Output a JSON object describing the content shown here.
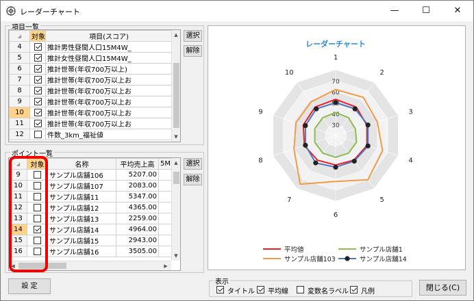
{
  "window": {
    "title": "レーダーチャート",
    "minimize": "—",
    "maximize": "☐",
    "close": "✕"
  },
  "items_group": {
    "label": "項目一覧",
    "headers": [
      "対象",
      "項目(スコア)"
    ],
    "rows": [
      {
        "n": "4",
        "checked": true,
        "name": "推計男性昼間人口15M4W_"
      },
      {
        "n": "5",
        "checked": true,
        "name": "推計女性昼間人口15M4W_"
      },
      {
        "n": "6",
        "checked": true,
        "name": "推計世帯(年収700万以上)"
      },
      {
        "n": "7",
        "checked": true,
        "name": "推計世帯(年収700万以上お"
      },
      {
        "n": "8",
        "checked": true,
        "name": "推計世帯(年収700万以上お"
      },
      {
        "n": "9",
        "checked": true,
        "name": "推計世帯(年収700万以上お"
      },
      {
        "n": "10",
        "checked": true,
        "name": "推計世帯(年収700万以上お"
      },
      {
        "n": "11",
        "checked": true,
        "name": "推計世帯(年収700万以上お"
      },
      {
        "n": "12",
        "checked": false,
        "name": "件数_3km_福祉値"
      }
    ],
    "select_btn": "選択",
    "clear_btn": "解除"
  },
  "points_group": {
    "label": "ポイント一覧",
    "headers": [
      "対象",
      "名称",
      "平均売上高",
      "5M"
    ],
    "rows": [
      {
        "n": "9",
        "checked": false,
        "name": "サンプル店舗106",
        "value": "5207.00"
      },
      {
        "n": "10",
        "checked": false,
        "name": "サンプル店舗107",
        "value": "2083.00"
      },
      {
        "n": "11",
        "checked": false,
        "name": "サンプル店舗11",
        "value": "5347.00"
      },
      {
        "n": "12",
        "checked": false,
        "name": "サンプル店舗12",
        "value": "4365.00"
      },
      {
        "n": "13",
        "checked": false,
        "name": "サンプル店舗13",
        "value": "2259.00"
      },
      {
        "n": "14",
        "checked": true,
        "name": "サンプル店舗14",
        "value": "4964.00"
      },
      {
        "n": "15",
        "checked": false,
        "name": "サンプル店舗15",
        "value": "2943.00"
      },
      {
        "n": "16",
        "checked": false,
        "name": "サンプル店舗16",
        "value": "3505.00"
      }
    ],
    "select_btn": "選択",
    "clear_btn": "解除"
  },
  "settings_btn": "設 定",
  "display_group": {
    "label": "表示",
    "options": [
      {
        "label": "タイトル",
        "checked": true
      },
      {
        "label": "平均線",
        "checked": true
      },
      {
        "label": "変数名ラベル",
        "checked": false
      },
      {
        "label": "凡例",
        "checked": true
      }
    ]
  },
  "close_btn": "閉じる(C)",
  "chart_data": {
    "type": "radar",
    "title": "レーダーチャート",
    "axes": [
      "1",
      "2",
      "3",
      "4",
      "5",
      "6",
      "7",
      "8",
      "9",
      "10"
    ],
    "rticks": [
      "30",
      "40",
      "50",
      "60",
      "70"
    ],
    "rlim": [
      20,
      80
    ],
    "series": [
      {
        "name": "平均値",
        "color": "#e8202a",
        "values": [
          53,
          52,
          50,
          50,
          48,
          47,
          48,
          50,
          51,
          52
        ]
      },
      {
        "name": "サンプル店舗1",
        "color": "#8cbc4c",
        "values": [
          41,
          40,
          39,
          40,
          40,
          40,
          40,
          40,
          40,
          40
        ]
      },
      {
        "name": "サンプル店舗103",
        "color": "#f39a46",
        "values": [
          62,
          63,
          60,
          65,
          70,
          62,
          75,
          60,
          58,
          58
        ]
      },
      {
        "name": "サンプル店舗14",
        "color": "#4a74c4",
        "values": [
          50,
          50,
          51,
          51,
          49,
          49,
          51,
          49,
          49,
          50
        ]
      }
    ]
  }
}
